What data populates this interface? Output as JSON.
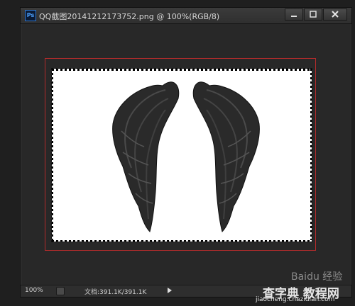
{
  "window": {
    "app_badge": "Ps",
    "title": "QQ截图20141212173752.png @ 100%(RGB/8)"
  },
  "controls": {
    "minimize_icon": "minimize-icon",
    "maximize_icon": "maximize-icon",
    "close_icon": "close-icon"
  },
  "statusbar": {
    "zoom": "100%",
    "doc_size": "文档:391.1K/391.1K"
  },
  "watermark": {
    "baidu": "Baidu 经验",
    "site_name": "查字典 教程网",
    "url": "jiaocheng.chazidian.com"
  },
  "colors": {
    "selection_frame": "#b32b2b",
    "canvas_bg": "#282828",
    "document_bg": "#ffffff"
  }
}
